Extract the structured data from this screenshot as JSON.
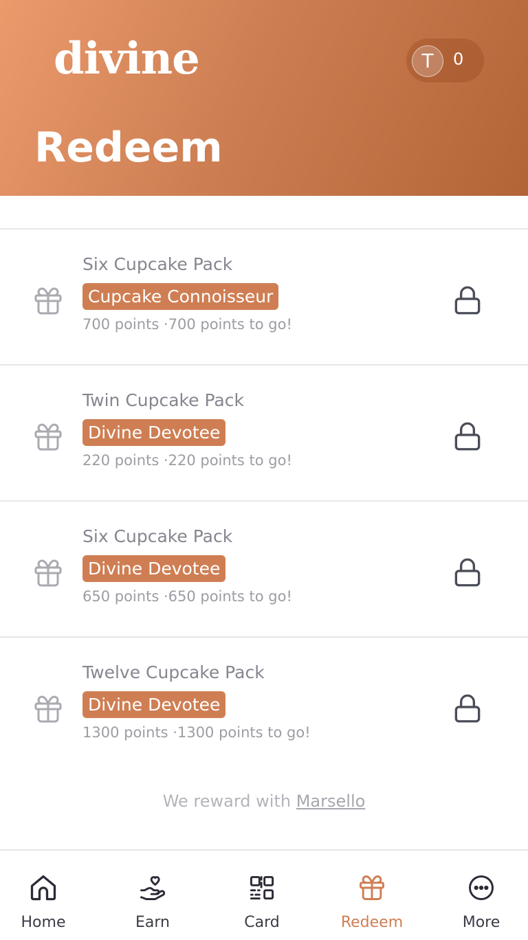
{
  "brand": {
    "logo_text": "divine",
    "accent_color": "#cf7e53"
  },
  "header": {
    "title": "Redeem",
    "avatar_initial": "T",
    "points_balance": "0"
  },
  "rewards": [
    {
      "name": "Six Cupcake Pack",
      "tier": "Cupcake Connoisseur",
      "points": "700 points ·700 points to go!",
      "icon": "gift-icon",
      "status_icon": "lock-icon"
    },
    {
      "name": "Twin Cupcake Pack",
      "tier": "Divine Devotee",
      "points": "220 points ·220 points to go!",
      "icon": "gift-icon",
      "status_icon": "lock-icon"
    },
    {
      "name": "Six Cupcake Pack",
      "tier": "Divine Devotee",
      "points": "650 points ·650 points to go!",
      "icon": "gift-icon",
      "status_icon": "lock-icon"
    },
    {
      "name": "Twelve Cupcake Pack",
      "tier": "Divine Devotee",
      "points": "1300 points ·1300 points to go!",
      "icon": "gift-icon",
      "status_icon": "lock-icon"
    }
  ],
  "footer": {
    "prefix": "We reward with ",
    "link_text": "Marsello"
  },
  "tabs": [
    {
      "label": "Home",
      "icon": "home-icon",
      "active": false
    },
    {
      "label": "Earn",
      "icon": "hand-heart-icon",
      "active": false
    },
    {
      "label": "Card",
      "icon": "qr-code-icon",
      "active": false
    },
    {
      "label": "Redeem",
      "icon": "gift-icon",
      "active": true
    },
    {
      "label": "More",
      "icon": "more-icon",
      "active": false
    }
  ]
}
